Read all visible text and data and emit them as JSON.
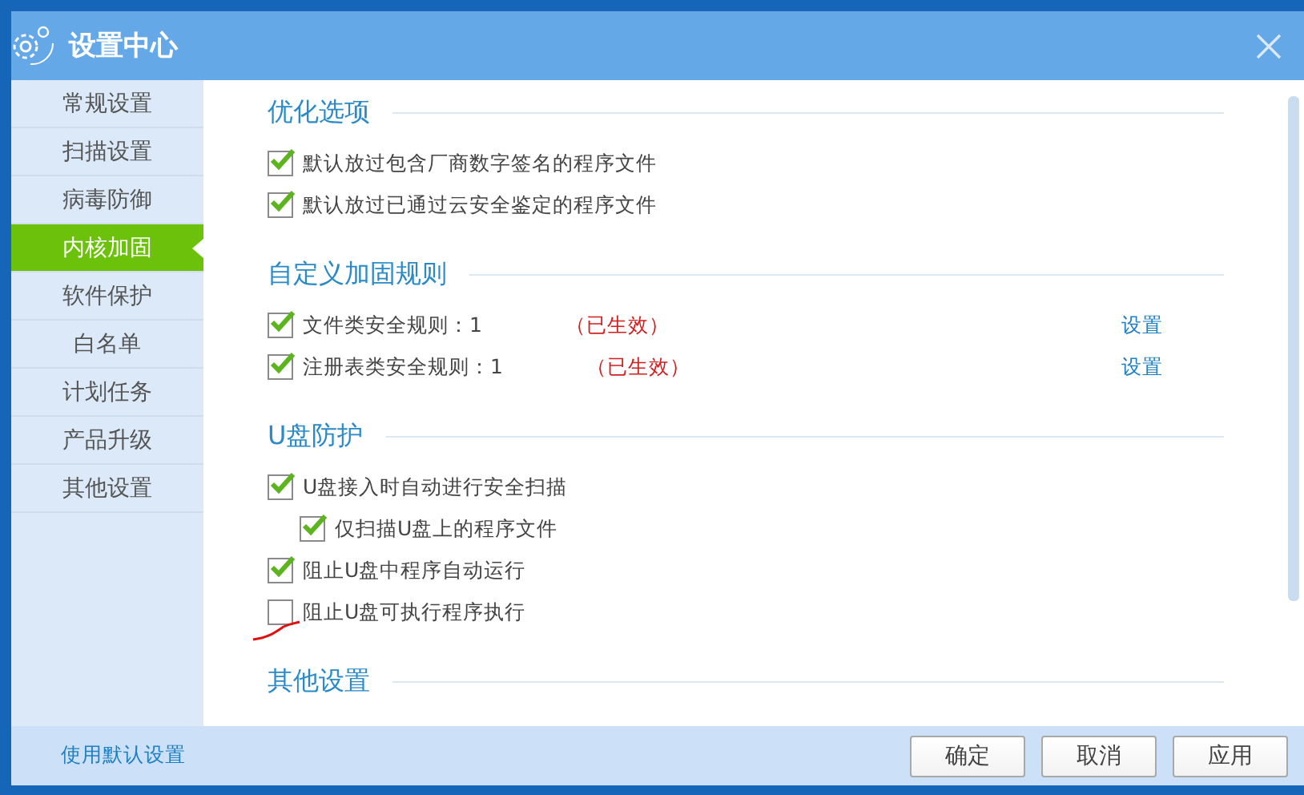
{
  "window": {
    "title": "设置中心"
  },
  "sidebar": {
    "items": [
      {
        "label": "常规设置",
        "selected": false
      },
      {
        "label": "扫描设置",
        "selected": false
      },
      {
        "label": "病毒防御",
        "selected": false
      },
      {
        "label": "内核加固",
        "selected": true
      },
      {
        "label": "软件保护",
        "selected": false
      },
      {
        "label": "白名单",
        "selected": false
      },
      {
        "label": "计划任务",
        "selected": false
      },
      {
        "label": "产品升级",
        "selected": false
      },
      {
        "label": "其他设置",
        "selected": false
      }
    ]
  },
  "sections": [
    {
      "title": "优化选项",
      "kind": "checks",
      "items": [
        {
          "label": "默认放过包含厂商数字签名的程序文件",
          "checked": true
        },
        {
          "label": "默认放过已通过云安全鉴定的程序文件",
          "checked": true
        }
      ]
    },
    {
      "title": "自定义加固规则",
      "kind": "rules",
      "items": [
        {
          "label": "文件类安全规则：1",
          "checked": true,
          "status": "（已生效）",
          "action": "设置"
        },
        {
          "label": "注册表类安全规则：1",
          "checked": true,
          "status": "（已生效）",
          "action": "设置"
        }
      ]
    },
    {
      "title": "U盘防护",
      "kind": "checks",
      "items": [
        {
          "label": "U盘接入时自动进行安全扫描",
          "checked": true,
          "children": [
            {
              "label": "仅扫描U盘上的程序文件",
              "checked": true
            }
          ]
        },
        {
          "label": "阻止U盘中程序自动运行",
          "checked": true
        },
        {
          "label": "阻止U盘可执行程序执行",
          "checked": false
        }
      ]
    },
    {
      "title": "其他设置",
      "kind": "heading"
    }
  ],
  "footer": {
    "link": "使用默认设置",
    "buttons": [
      "确定",
      "取消",
      "应用"
    ]
  }
}
